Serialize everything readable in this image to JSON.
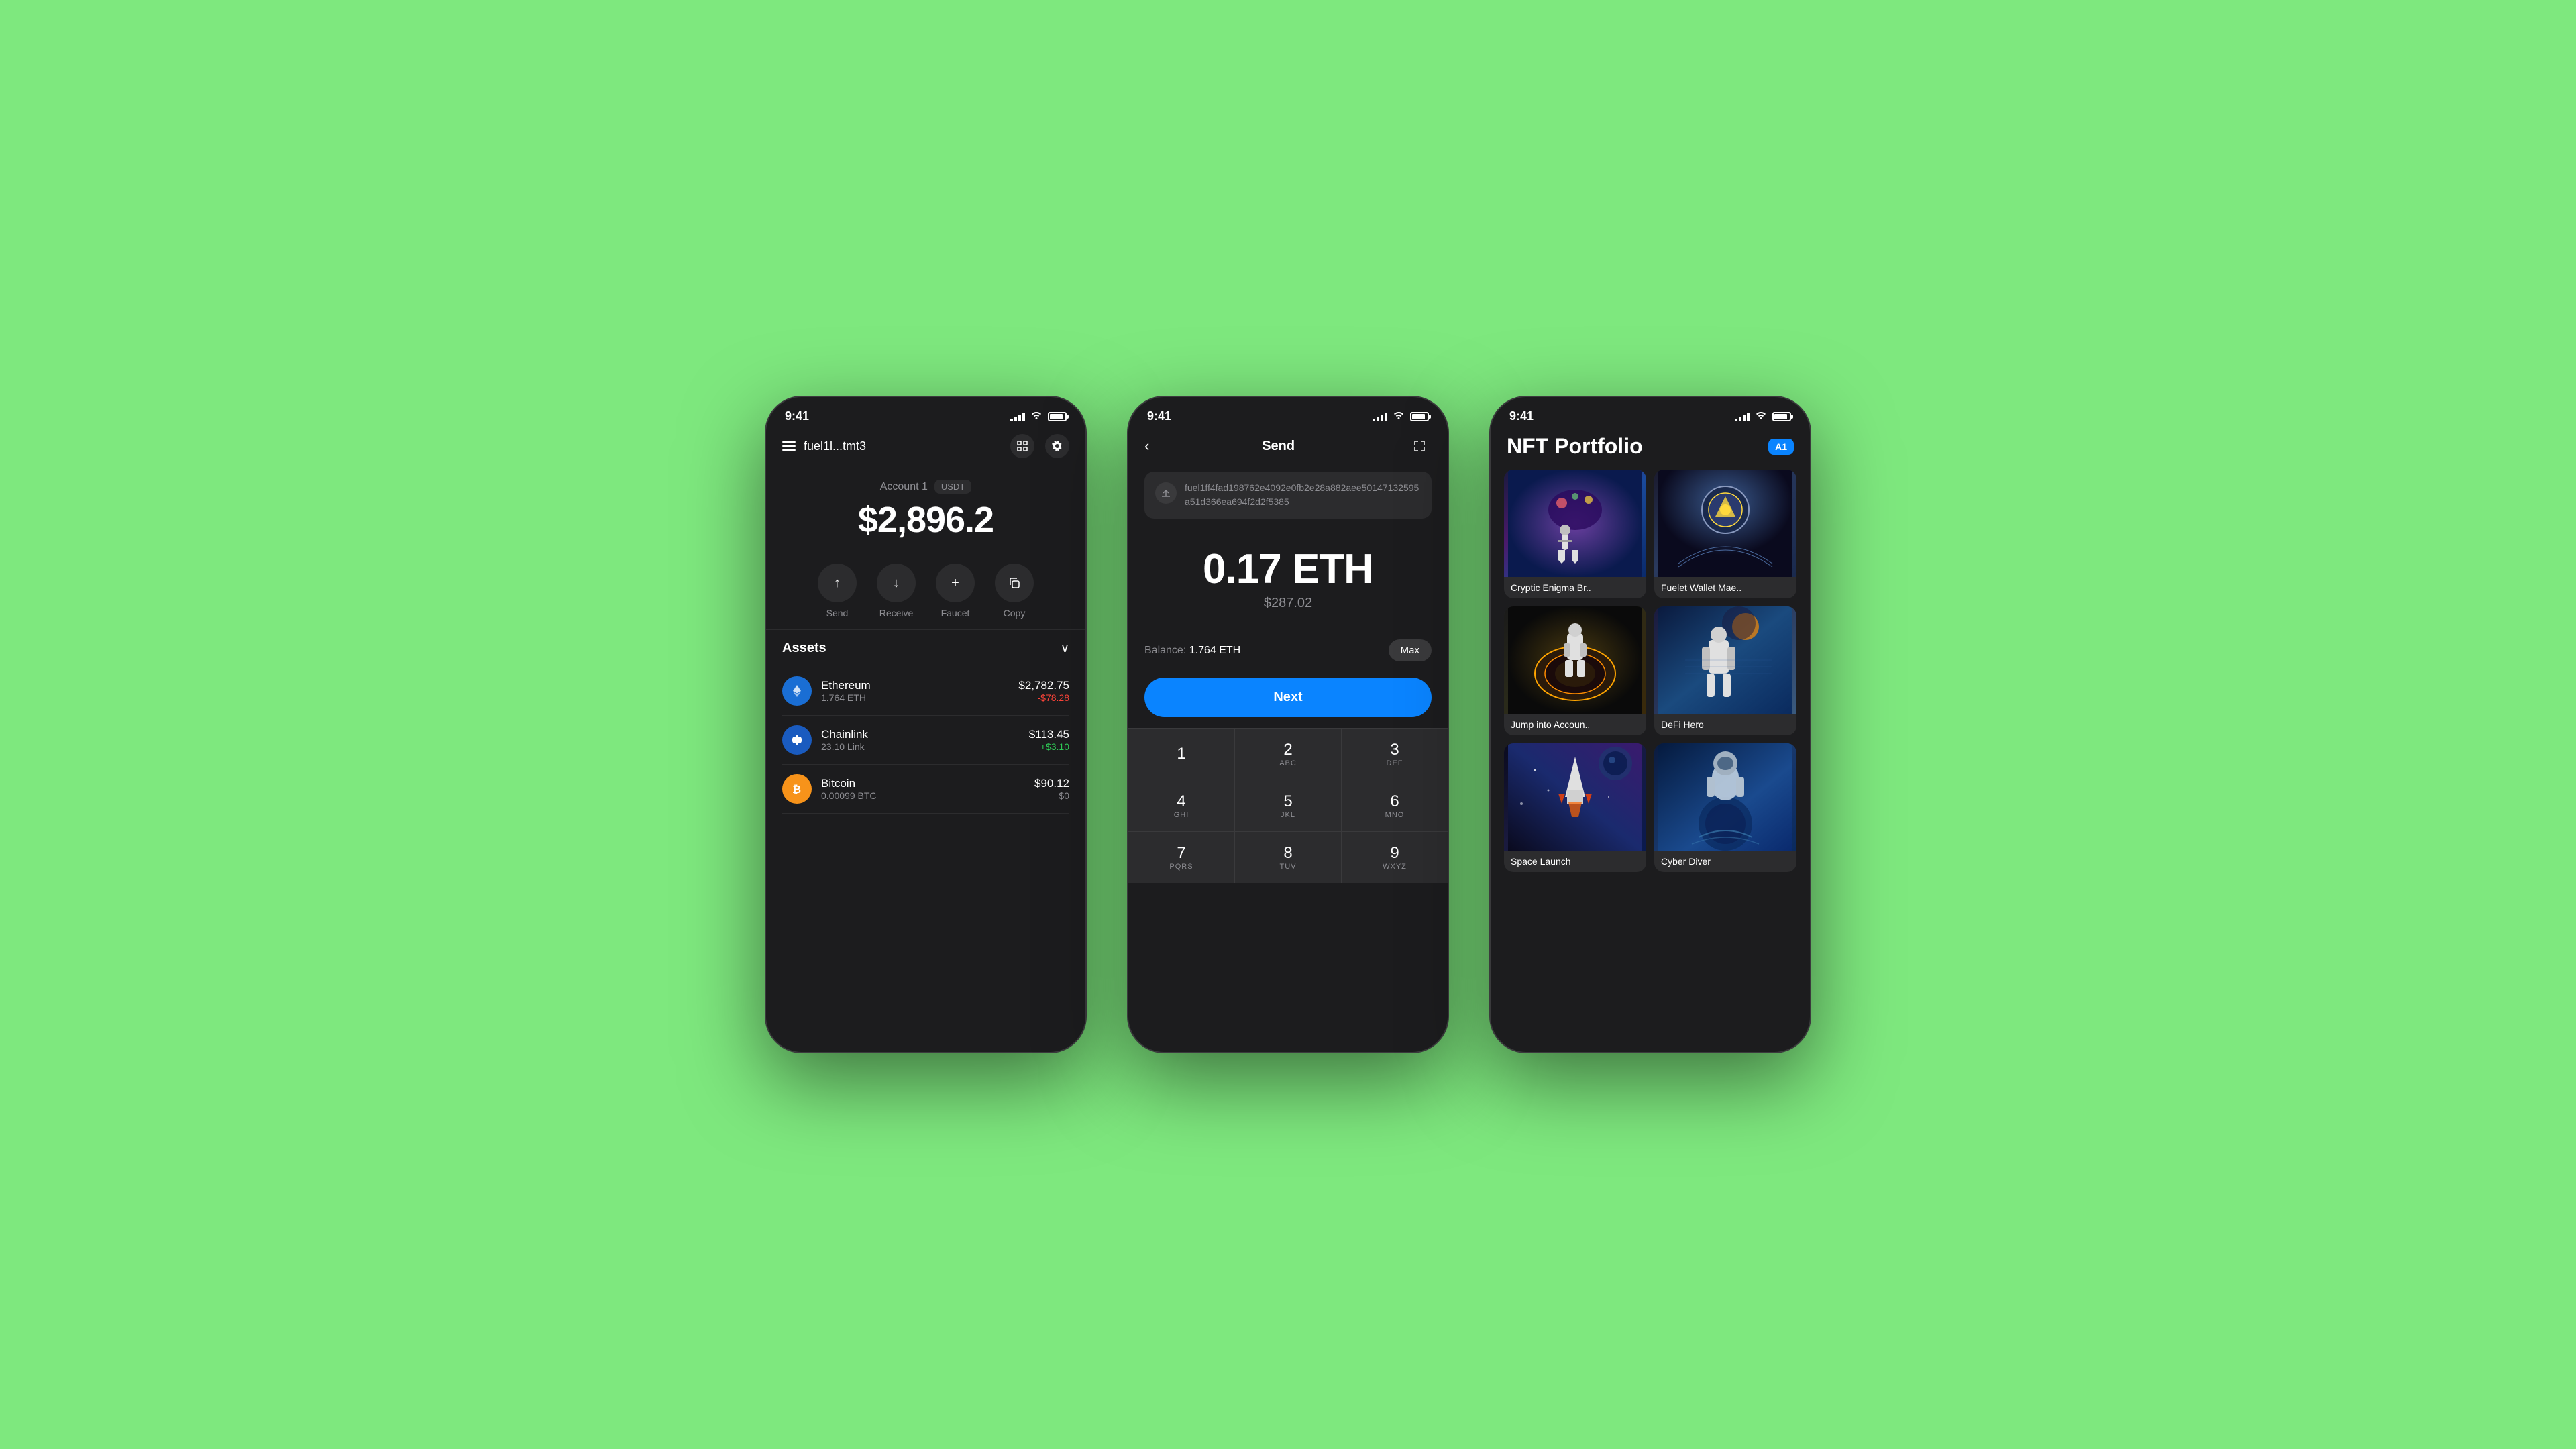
{
  "background": "#7de87d",
  "phone1": {
    "statusBar": {
      "time": "9:41",
      "timeRight": "9:41"
    },
    "header": {
      "walletAddress": "fuel1l...tmt3",
      "menuLabel": "menu"
    },
    "account": {
      "label": "Account 1",
      "badge": "USDT",
      "balance": "$2,896.2"
    },
    "actions": [
      {
        "label": "Send",
        "icon": "↑"
      },
      {
        "label": "Receive",
        "icon": "↓"
      },
      {
        "label": "Faucet",
        "icon": "+"
      },
      {
        "label": "Copy",
        "icon": "⊡"
      }
    ],
    "assetsTitle": "Assets",
    "assets": [
      {
        "name": "Ethereum",
        "amount": "1.764 ETH",
        "price": "$2,782.75",
        "change": "-$78.28",
        "changeType": "negative",
        "iconColor": "#1a6ed4",
        "iconChar": "⟠"
      },
      {
        "name": "Chainlink",
        "amount": "23.10 Link",
        "price": "$113.45",
        "change": "+$3.10",
        "changeType": "positive",
        "iconColor": "#1a5bbf",
        "iconChar": "⬡"
      },
      {
        "name": "Bitcoin",
        "amount": "0.00099 BTC",
        "price": "$90.12",
        "change": "$0",
        "changeType": "neutral",
        "iconColor": "#f7931a",
        "iconChar": "₿"
      }
    ]
  },
  "phone2": {
    "statusBar": {
      "time": "9:41"
    },
    "header": {
      "title": "Send",
      "backLabel": "back"
    },
    "address": "fuel1ff4fad198762e4092e0fb2e28a882aee50147132595a51d366ea694f2d2f5385",
    "amount": "0.17 ETH",
    "amountUsd": "$287.02",
    "balanceLabel": "Balance:",
    "balanceValue": "1.764 ETH",
    "maxButton": "Max",
    "nextButton": "Next",
    "numpad": [
      {
        "number": "1",
        "letters": ""
      },
      {
        "number": "2",
        "letters": "ABC"
      },
      {
        "number": "3",
        "letters": "DEF"
      },
      {
        "number": "4",
        "letters": "GHI"
      },
      {
        "number": "5",
        "letters": "JKL"
      },
      {
        "number": "6",
        "letters": "MNO"
      },
      {
        "number": "7",
        "letters": "PQRS"
      },
      {
        "number": "8",
        "letters": "TUV"
      },
      {
        "number": "9",
        "letters": "WXYZ"
      }
    ]
  },
  "phone3": {
    "statusBar": {
      "time": "9:41"
    },
    "header": {
      "title": "NFT Portfolio",
      "badge": "A1"
    },
    "nfts": [
      {
        "name": "Cryptic Enigma Br..",
        "gradient": "nft-1"
      },
      {
        "name": "Fuelet Wallet Mae..",
        "gradient": "nft-2"
      },
      {
        "name": "Jump into Accoun..",
        "gradient": "nft-3"
      },
      {
        "name": "DeFi Hero",
        "gradient": "nft-4"
      },
      {
        "name": "Space Launch",
        "gradient": "nft-5"
      },
      {
        "name": "Cyber Diver",
        "gradient": "nft-6"
      }
    ]
  }
}
